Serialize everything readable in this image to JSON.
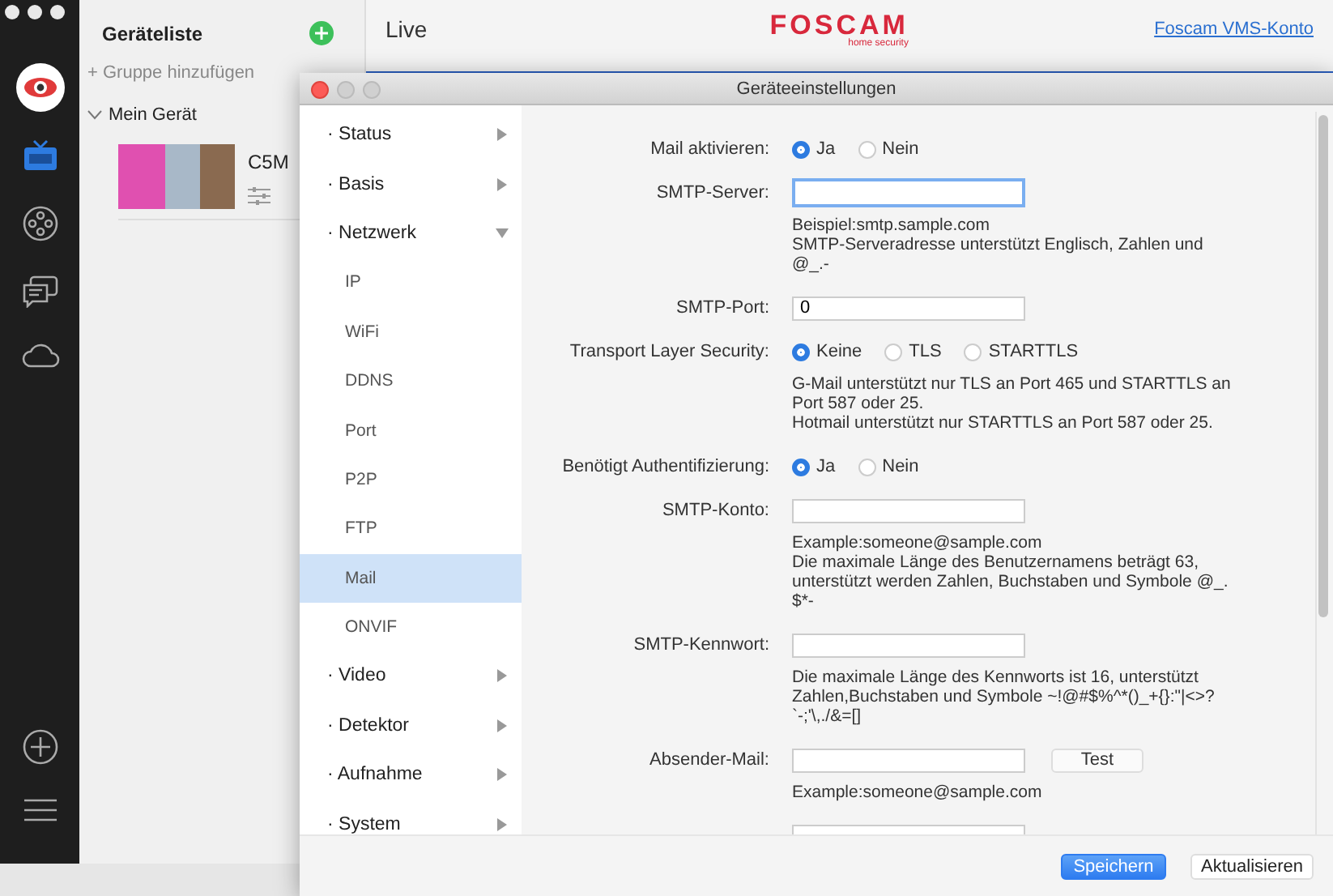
{
  "app": {
    "device_list": {
      "title": "Geräteliste",
      "add_group": "+ Gruppe hinzufügen",
      "group": {
        "name": "Mein Gerät",
        "expanded": true,
        "devices": [
          {
            "name": "C5M"
          }
        ]
      }
    },
    "header": {
      "tab": "Live",
      "logo": "FOSCAM",
      "logo_tagline": "home security",
      "account_link": "Foscam VMS-Konto"
    }
  },
  "dialog": {
    "title": "Geräteeinstellungen",
    "nav": [
      {
        "label": "· Status",
        "expanded": false,
        "selected": false
      },
      {
        "label": "· Basis",
        "expanded": false,
        "selected": false
      },
      {
        "label": "· Netzwerk",
        "expanded": true,
        "selected": false,
        "children": [
          {
            "label": "IP",
            "selected": false
          },
          {
            "label": "WiFi",
            "selected": false
          },
          {
            "label": "DDNS",
            "selected": false
          },
          {
            "label": "Port",
            "selected": false
          },
          {
            "label": "P2P",
            "selected": false
          },
          {
            "label": "FTP",
            "selected": false
          },
          {
            "label": "Mail",
            "selected": true
          },
          {
            "label": "ONVIF",
            "selected": false
          }
        ]
      },
      {
        "label": "· Video",
        "expanded": false,
        "selected": false
      },
      {
        "label": "· Detektor",
        "expanded": false,
        "selected": false
      },
      {
        "label": "· Aufnahme",
        "expanded": false,
        "selected": false
      },
      {
        "label": "· System",
        "expanded": false,
        "selected": false
      }
    ],
    "form": [
      {
        "kind": "radio",
        "label": "Mail aktivieren:",
        "options": [
          {
            "label": "Ja",
            "selected": true
          },
          {
            "label": "Nein",
            "selected": false
          }
        ]
      },
      {
        "kind": "input",
        "label": "SMTP-Server:",
        "focused": true,
        "hints": [
          "Beispiel:smtp.sample.com",
          "SMTP-Serveradresse unterstützt Englisch, Zahlen und @_.-"
        ]
      },
      {
        "kind": "input",
        "label": "SMTP-Port:",
        "value": "0",
        "focused": false
      },
      {
        "kind": "radio",
        "label": "Transport Layer Security:",
        "options": [
          {
            "label": "Keine",
            "selected": true
          },
          {
            "label": "TLS",
            "selected": false
          },
          {
            "label": "STARTTLS",
            "selected": false
          }
        ],
        "hints": [
          "G-Mail unterstützt nur TLS an Port 465 und STARTTLS an Port 587 oder 25.",
          "Hotmail unterstützt nur STARTTLS an Port 587 oder 25."
        ]
      },
      {
        "kind": "radio",
        "label": "Benötigt Authentifizierung:",
        "options": [
          {
            "label": "Ja",
            "selected": true
          },
          {
            "label": "Nein",
            "selected": false
          }
        ]
      },
      {
        "kind": "input",
        "label": "SMTP-Konto:",
        "focused": false,
        "hints": [
          "Example:someone@sample.com",
          "Die maximale Länge des Benutzernamens beträgt 63, unterstützt werden Zahlen, Buchstaben und Symbole @_. $*-"
        ]
      },
      {
        "kind": "input",
        "label": "SMTP-Kennwort:",
        "focused": false,
        "hints": [
          "Die maximale Länge des Kennworts ist 16, unterstützt Zahlen,Buchstaben und Symbole ~!@#$%^*()_+{}:\"|<>? `-;'\\,./&=[]"
        ]
      },
      {
        "kind": "input",
        "label": "Absender-Mail:",
        "focused": false,
        "button": "Test",
        "hints": [
          "Example:someone@sample.com"
        ]
      },
      {
        "kind": "input",
        "focused": false
      }
    ],
    "buttons": [
      {
        "label": "Speichern",
        "primary": true
      },
      {
        "label": "Aktualisieren",
        "primary": false
      }
    ]
  }
}
